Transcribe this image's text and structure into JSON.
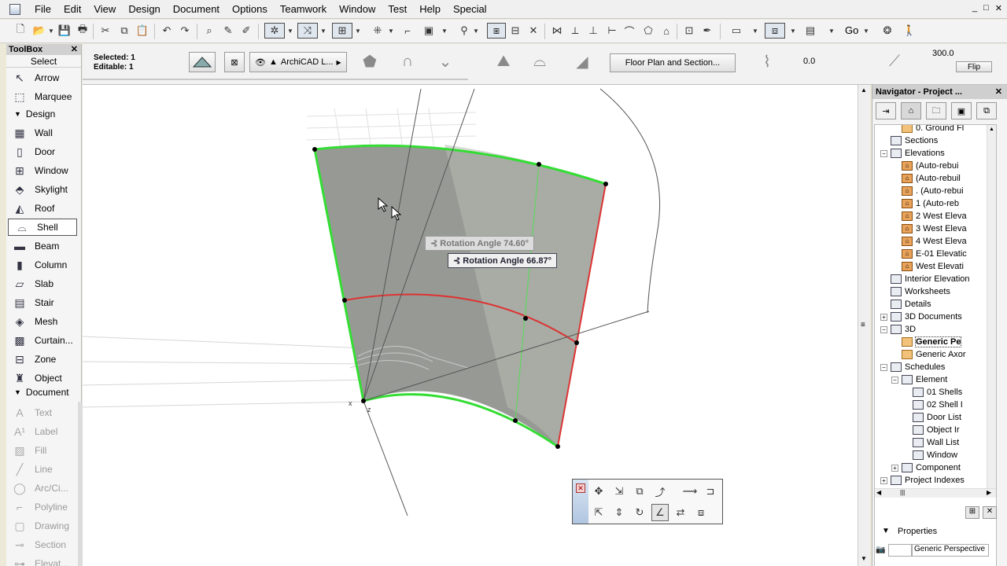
{
  "menu": {
    "items": [
      "File",
      "Edit",
      "View",
      "Design",
      "Document",
      "Options",
      "Teamwork",
      "Window",
      "Test",
      "Help",
      "Special"
    ],
    "window_controls": [
      "_",
      "□",
      "✕"
    ]
  },
  "toolbar": {
    "go_label": "Go"
  },
  "infobox": {
    "selected": "Selected: 1",
    "editable": "Editable: 1",
    "layer_name": "ArchiCAD L...",
    "floorplan_button": "Floor Plan and Section...",
    "thickness_value": "0.0",
    "height_value": "300.0",
    "flip_button": "Flip"
  },
  "toolbox": {
    "title": "ToolBox",
    "close": "✕",
    "select_label": "Select",
    "select_tools": [
      {
        "label": "Arrow",
        "icon": "arrow-icon"
      },
      {
        "label": "Marquee",
        "icon": "marquee-icon"
      }
    ],
    "design_header": "Design",
    "design_tools": [
      {
        "label": "Wall",
        "icon": "wall-icon"
      },
      {
        "label": "Door",
        "icon": "door-icon"
      },
      {
        "label": "Window",
        "icon": "window-icon"
      },
      {
        "label": "Skylight",
        "icon": "skylight-icon"
      },
      {
        "label": "Roof",
        "icon": "roof-icon"
      },
      {
        "label": "Shell",
        "icon": "shell-icon",
        "active": true
      },
      {
        "label": "Beam",
        "icon": "beam-icon"
      },
      {
        "label": "Column",
        "icon": "column-icon"
      },
      {
        "label": "Slab",
        "icon": "slab-icon"
      },
      {
        "label": "Stair",
        "icon": "stair-icon"
      },
      {
        "label": "Mesh",
        "icon": "mesh-icon"
      },
      {
        "label": "Curtain...",
        "icon": "curtain-wall-icon"
      },
      {
        "label": "Zone",
        "icon": "zone-icon"
      },
      {
        "label": "Object",
        "icon": "object-icon"
      }
    ],
    "document_header": "Document",
    "document_tools": [
      {
        "label": "Text",
        "icon": "text-icon"
      },
      {
        "label": "Label",
        "icon": "label-icon"
      },
      {
        "label": "Fill",
        "icon": "fill-icon"
      },
      {
        "label": "Line",
        "icon": "line-icon"
      },
      {
        "label": "Arc/Ci...",
        "icon": "arc-icon"
      },
      {
        "label": "Polyline",
        "icon": "polyline-icon"
      },
      {
        "label": "Drawing",
        "icon": "drawing-icon"
      },
      {
        "label": "Section",
        "icon": "section-icon"
      },
      {
        "label": "Elevat...",
        "icon": "elevation-icon"
      }
    ]
  },
  "viewport": {
    "tooltip_1": "Rotation Angle  74.60°",
    "tooltip_2": "Rotation Angle  66.87°",
    "axis_x": "x",
    "axis_z": "z",
    "colors": {
      "shell_fill": "#8e918b",
      "edge_green": "#33dd33",
      "edge_red": "#dd3333"
    }
  },
  "navigator": {
    "title": "Navigator - Project ...",
    "close": "✕",
    "tree": [
      {
        "label": "0. Ground Fl",
        "indent": 3,
        "icon": "folder"
      },
      {
        "label": "Sections",
        "indent": 2,
        "icon": "sheet"
      },
      {
        "label": "Elevations",
        "indent": 2,
        "icon": "sheet",
        "expander": "−"
      },
      {
        "label": "(Auto-rebui",
        "indent": 3,
        "icon": "house"
      },
      {
        "label": "(Auto-rebuil",
        "indent": 3,
        "icon": "house"
      },
      {
        "label": ". (Auto-rebui",
        "indent": 3,
        "icon": "house"
      },
      {
        "label": "1  (Auto-reb",
        "indent": 3,
        "icon": "house"
      },
      {
        "label": "2 West Eleva",
        "indent": 3,
        "icon": "house"
      },
      {
        "label": "3 West Eleva",
        "indent": 3,
        "icon": "house"
      },
      {
        "label": "4 West Eleva",
        "indent": 3,
        "icon": "house"
      },
      {
        "label": "E-01 Elevatic",
        "indent": 3,
        "icon": "house"
      },
      {
        "label": "West Elevati",
        "indent": 3,
        "icon": "house"
      },
      {
        "label": "Interior Elevation",
        "indent": 2,
        "icon": "sheet"
      },
      {
        "label": "Worksheets",
        "indent": 2,
        "icon": "sheet"
      },
      {
        "label": "Details",
        "indent": 2,
        "icon": "sheet"
      },
      {
        "label": "3D Documents",
        "indent": 2,
        "icon": "sheet",
        "expander": "+"
      },
      {
        "label": "3D",
        "indent": 2,
        "icon": "sheet",
        "expander": "−"
      },
      {
        "label": "Generic Pe",
        "indent": 3,
        "icon": "folder",
        "selected": true
      },
      {
        "label": "Generic Axor",
        "indent": 3,
        "icon": "folder"
      },
      {
        "label": "Schedules",
        "indent": 2,
        "icon": "sheet",
        "expander": "−"
      },
      {
        "label": "Element",
        "indent": 3,
        "icon": "sheet",
        "expander": "−"
      },
      {
        "label": "01 Shells",
        "indent": 4,
        "icon": "sheet"
      },
      {
        "label": "02 Shell I",
        "indent": 4,
        "icon": "sheet"
      },
      {
        "label": "Door List",
        "indent": 4,
        "icon": "sheet"
      },
      {
        "label": "Object Ir",
        "indent": 4,
        "icon": "sheet"
      },
      {
        "label": "Wall List",
        "indent": 4,
        "icon": "sheet"
      },
      {
        "label": "Window",
        "indent": 4,
        "icon": "sheet"
      },
      {
        "label": "Component",
        "indent": 3,
        "icon": "sheet",
        "expander": "+"
      },
      {
        "label": "Project Indexes",
        "indent": 2,
        "icon": "sheet",
        "expander": "+"
      }
    ],
    "properties_label": "Properties",
    "properties_value": "Generic Perspective"
  }
}
